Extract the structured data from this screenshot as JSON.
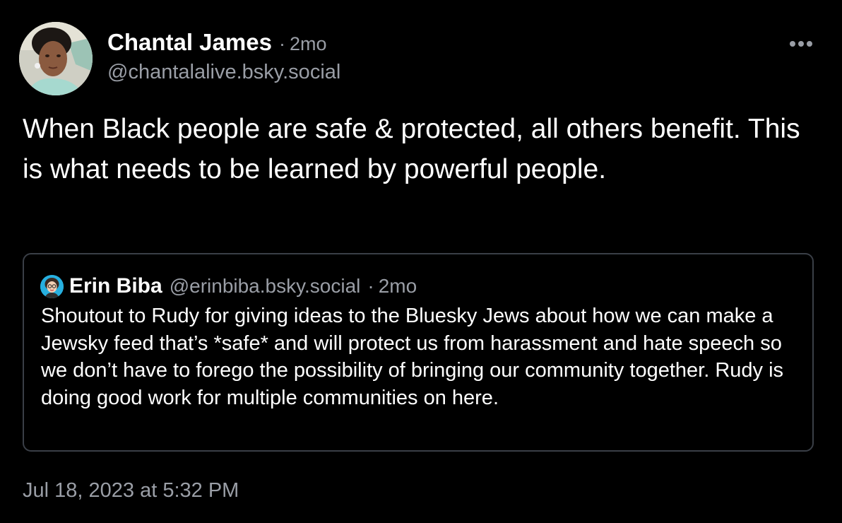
{
  "post": {
    "author": {
      "name": "Chantal James",
      "separator": "·",
      "relative_time": "2mo",
      "handle": "@chantalalive.bsky.social",
      "avatar_icon": "user-avatar-photo"
    },
    "more_icon": "ellipsis-horizontal-icon",
    "text": "When Black people are safe & protected, all others benefit. This is what needs to be learned by powerful people.",
    "quote": {
      "author": {
        "name": "Erin Biba",
        "handle": "@erinbiba.bsky.social",
        "separator": "·",
        "relative_time": "2mo",
        "avatar_icon": "cartoon-avatar"
      },
      "text": "Shoutout to Rudy for giving ideas to the Bluesky Jews about how we can make a Jewsky feed that’s *safe* and will protect us from harassment and hate speech so we don’t have to forego the possibility of bringing our community together. Rudy is doing good work for multiple communities on here."
    },
    "timestamp": "Jul 18, 2023 at 5:32 PM"
  },
  "colors": {
    "background": "#000000",
    "text_primary": "#ffffff",
    "text_secondary": "#9a9ea6",
    "quote_border": "#3a3f47"
  }
}
